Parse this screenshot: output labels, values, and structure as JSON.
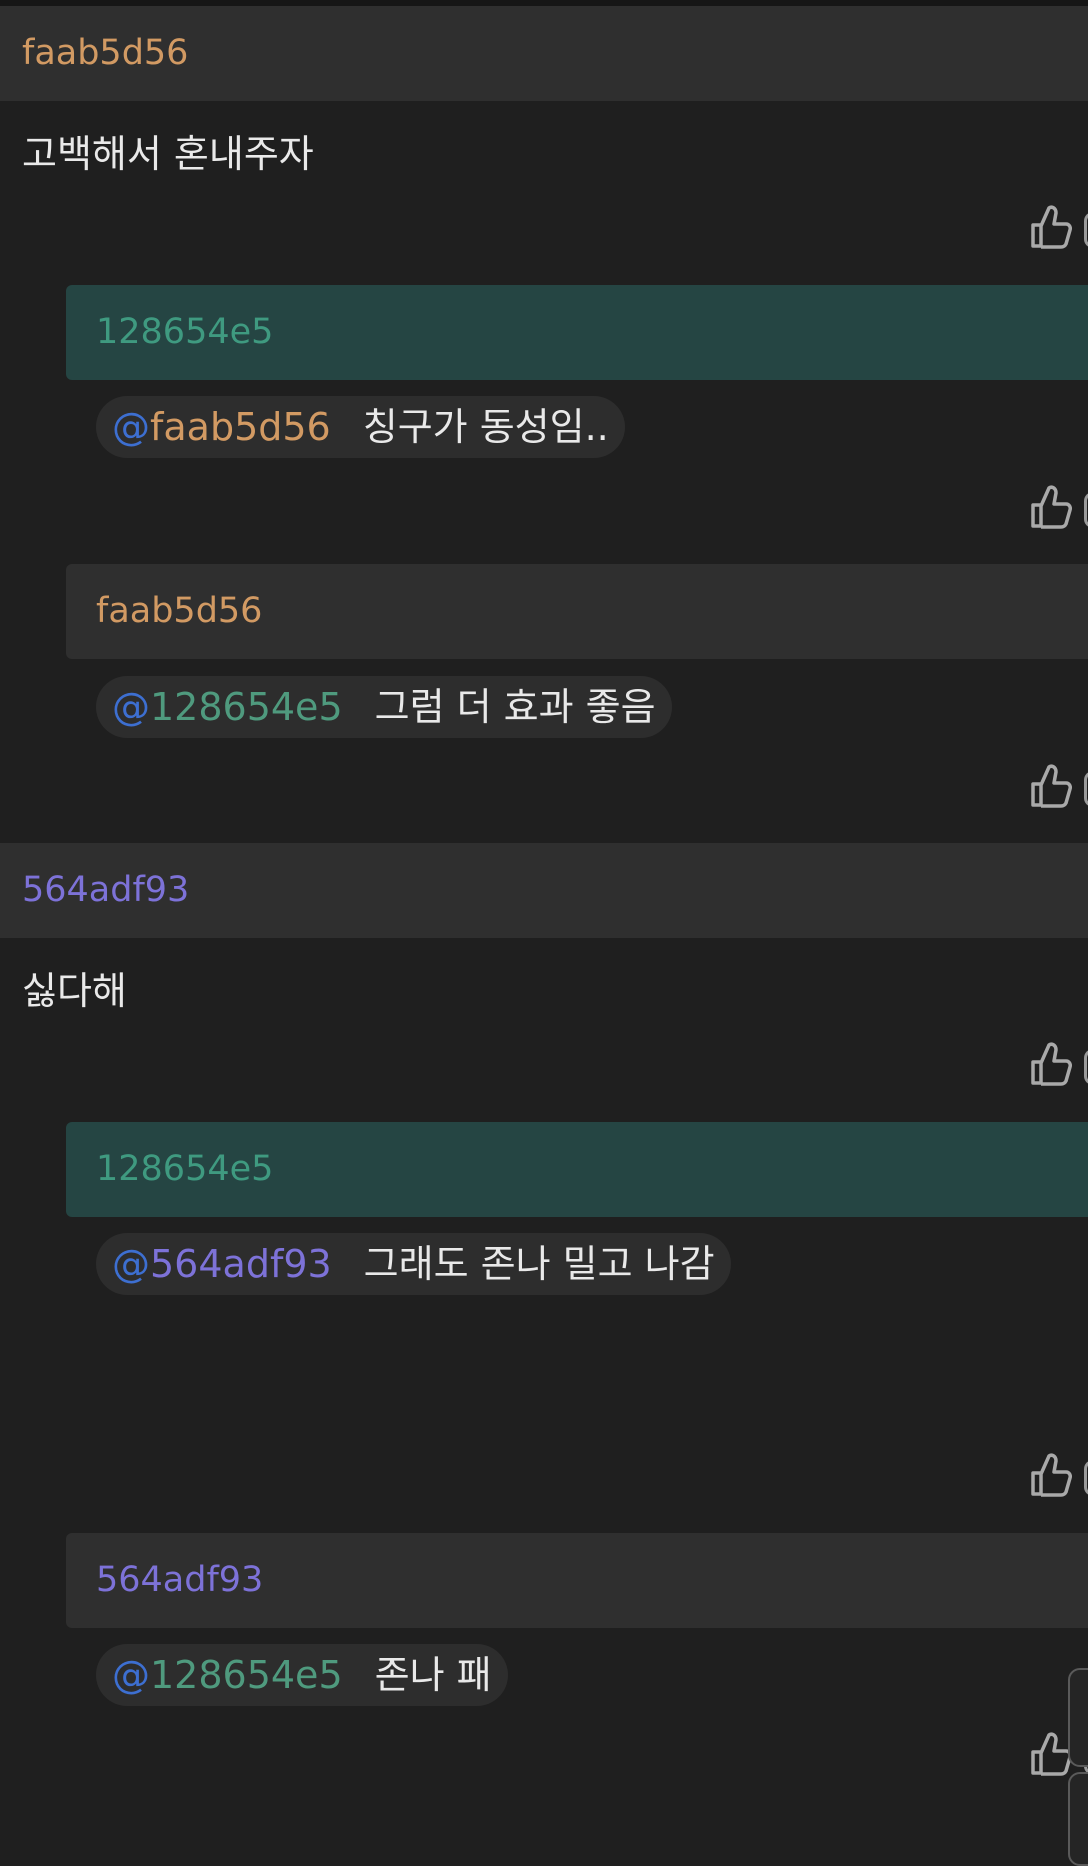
{
  "comments": [
    {
      "user": "faab5d56",
      "text": "고백해서 혼내주자",
      "replies": [
        {
          "user": "128654e5",
          "mention": "@faab5d56",
          "text": "칭구가 동성임.."
        },
        {
          "user": "faab5d56",
          "mention": "@128654e5",
          "text": "그럼 더 효과 좋음"
        }
      ]
    },
    {
      "user": "564adf93",
      "text": "싫다해",
      "replies": [
        {
          "user": "128654e5",
          "mention": "@564adf93",
          "text": "그래도 존나 밀고 나감"
        },
        {
          "user": "564adf93",
          "mention": "@128654e5",
          "text": "존나 패"
        }
      ]
    }
  ],
  "icons": {
    "like": "thumbs-up-icon"
  },
  "colors": {
    "background": "#1f1f1f",
    "header_bar": "#2f2f2f",
    "teal_bar": "#254543",
    "user_faab5d56": "#d29a63",
    "user_128654e5": "#4f9a7e",
    "user_564adf93": "#7d72d8",
    "mention_at": "#3d6fd1"
  }
}
